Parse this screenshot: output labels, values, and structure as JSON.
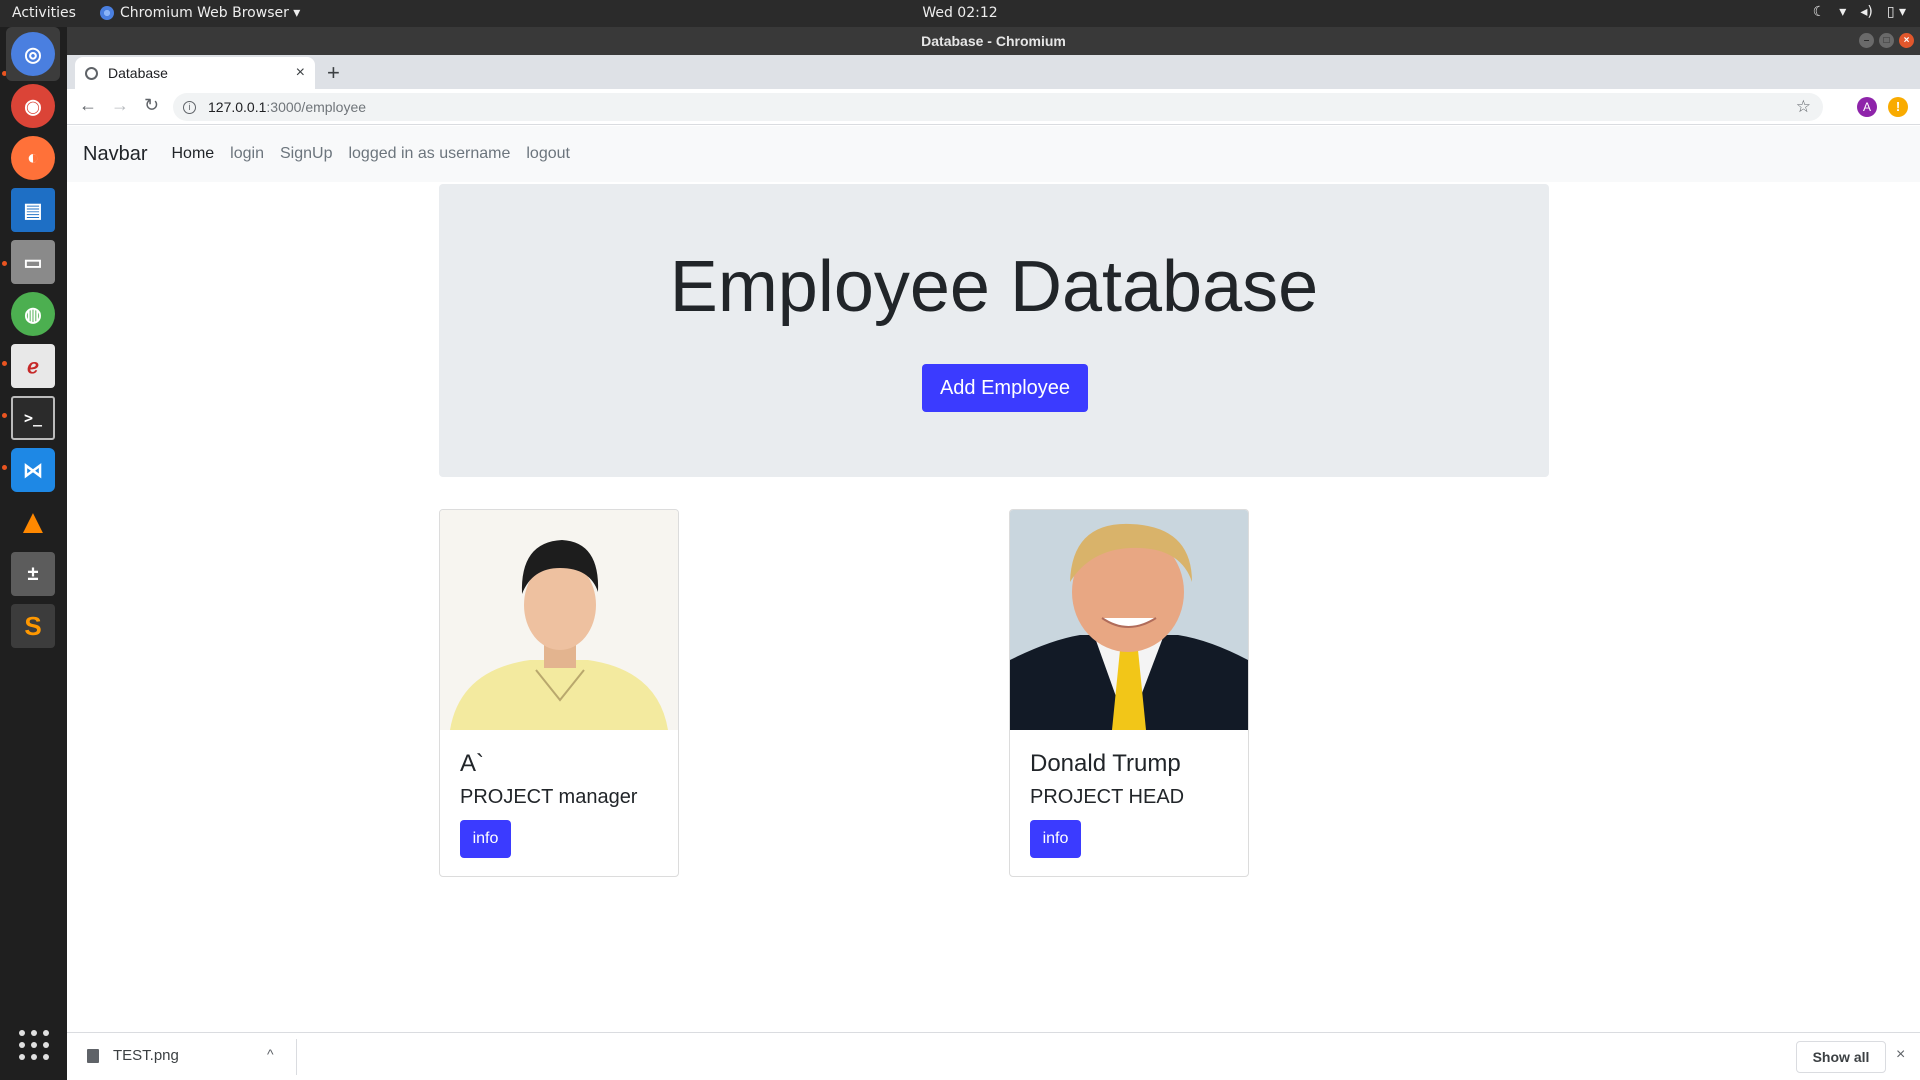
{
  "system_bar": {
    "activities": "Activities",
    "app_menu": "Chromium Web Browser ▾",
    "clock": "Wed 02:12",
    "tray": [
      "☾",
      "▾",
      "◂)",
      "▯ ▾"
    ]
  },
  "window": {
    "title": "Database - Chromium",
    "buttons": [
      "–",
      "□",
      "×"
    ]
  },
  "dock": {
    "apps": [
      {
        "name": "chromium",
        "glyph": "◎",
        "color": "#4a7fe0"
      },
      {
        "name": "chrome",
        "glyph": "◉",
        "color": "#db4437"
      },
      {
        "name": "firefox",
        "glyph": "◐",
        "color": "#ff7139"
      },
      {
        "name": "writer",
        "glyph": "▤",
        "color": "#1e6fc5"
      },
      {
        "name": "files",
        "glyph": "▭",
        "color": "#8a8a8a"
      },
      {
        "name": "globe",
        "glyph": "◍",
        "color": "#4caf50"
      },
      {
        "name": "pdf-viewer",
        "glyph": "ℯ",
        "color": "#e8e8e8"
      },
      {
        "name": "terminal",
        "glyph": ">_",
        "color": "#2b2b2b"
      },
      {
        "name": "vscode",
        "glyph": "⋈",
        "color": "#1e88e5"
      },
      {
        "name": "vlc",
        "glyph": "▲",
        "color": "#ff8800"
      },
      {
        "name": "calculator",
        "glyph": "±",
        "color": "#5c5c5c"
      },
      {
        "name": "sublime",
        "glyph": "S",
        "color": "#ff9800"
      }
    ]
  },
  "browser": {
    "tab": {
      "label": "Database",
      "close": "×"
    },
    "new_tab": "+",
    "nav": {
      "back": "←",
      "forward": "→",
      "reload": "↻"
    },
    "url": {
      "host": "127.0.0.1",
      "path": ":3000/employee"
    },
    "bookmark": "☆",
    "profile": "A",
    "alert": "!"
  },
  "site_nav": {
    "brand": "Navbar",
    "links": {
      "home": "Home",
      "login": "login",
      "signup": "SignUp",
      "status": "logged in as username",
      "logout": "logout"
    }
  },
  "jumbotron": {
    "title": "Employee Database",
    "button": "Add Employee"
  },
  "employees": [
    {
      "name": "A`",
      "role": "PROJECT manager",
      "button": "info"
    },
    {
      "name": "Donald Trump",
      "role": "PROJECT HEAD",
      "button": "info"
    }
  ],
  "download_bar": {
    "file": "TEST.png",
    "chevron": "^",
    "show_all": "Show all",
    "close": "×"
  },
  "colors": {
    "primary_button": "#3b3bff",
    "jumbotron_bg": "#e9ecef",
    "navbar_bg": "#f8f9fa"
  }
}
